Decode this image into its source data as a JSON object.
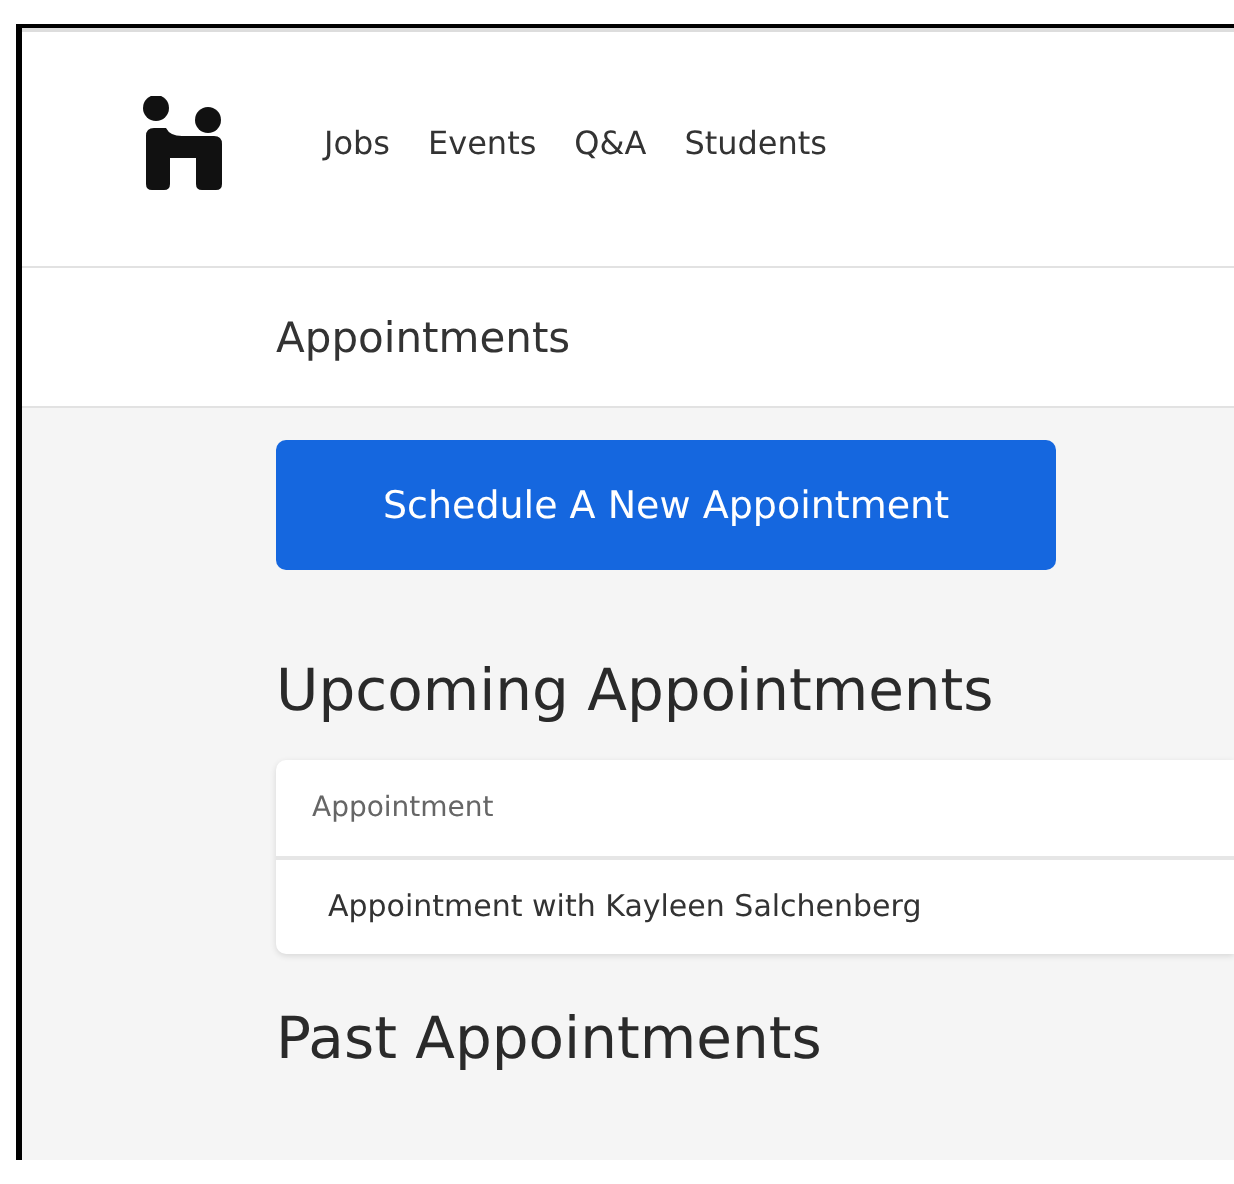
{
  "nav": {
    "items": [
      {
        "label": "Jobs"
      },
      {
        "label": "Events"
      },
      {
        "label": "Q&A"
      },
      {
        "label": "Students"
      }
    ]
  },
  "page_title": "Appointments",
  "schedule_button": "Schedule A New Appointment",
  "upcoming": {
    "heading": "Upcoming Appointments",
    "column": "Appointment",
    "rows": [
      "Appointment with Kayleen Salchenberg"
    ]
  },
  "past": {
    "heading": "Past Appointments"
  }
}
